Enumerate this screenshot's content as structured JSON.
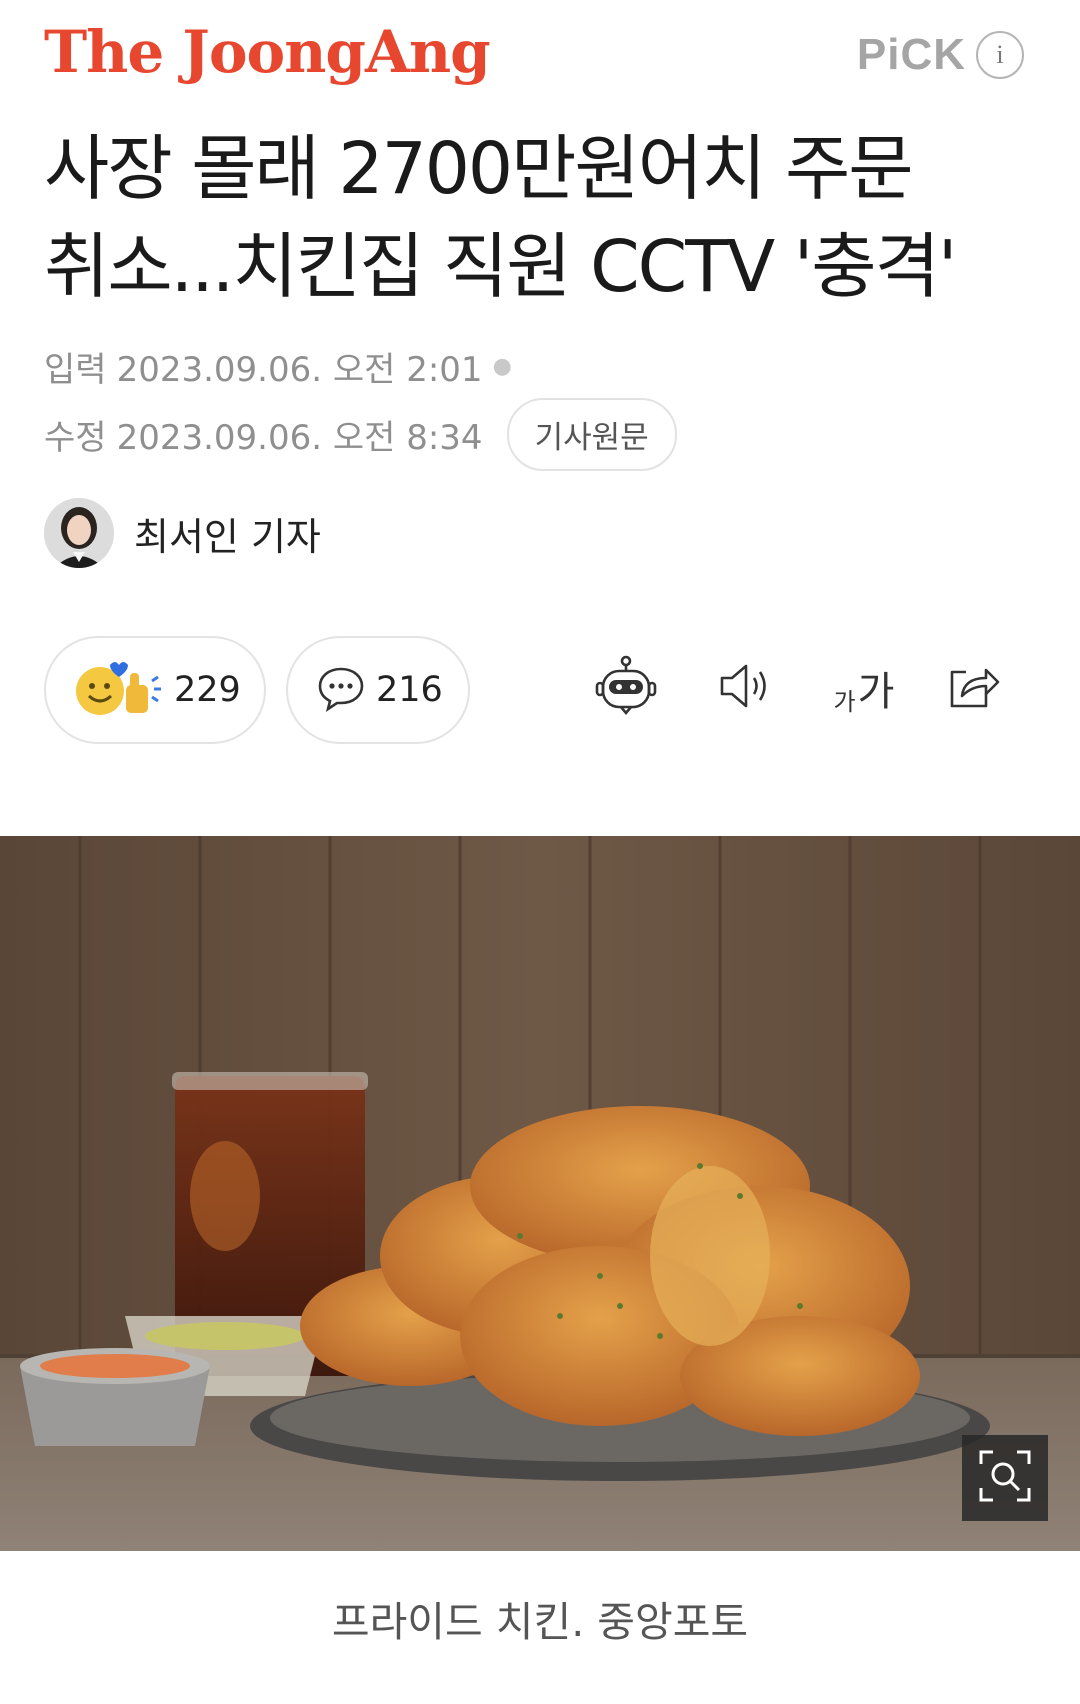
{
  "header": {
    "logo": "The JoongAng",
    "pick_label": "PiCK",
    "info_glyph": "i"
  },
  "article": {
    "title_line1": "사장 몰래 2700만원어치 주문",
    "title_line2": "취소...치킨집 직원 CCTV '충격'",
    "input_label": "입력",
    "input_datetime": "2023.09.06. 오전 2:01",
    "modified_label": "수정",
    "modified_datetime": "2023.09.06. 오전 8:34",
    "source_button": "기사원문",
    "author": "최서인 기자"
  },
  "actions": {
    "reaction_count": "229",
    "comment_count": "216",
    "font_size_label_small": "가",
    "font_size_label_large": "가",
    "icons": [
      "reaction-emoji-icon",
      "comment-bubble-icon",
      "summary-bot-icon",
      "speaker-icon",
      "font-size-icon",
      "share-icon"
    ]
  },
  "photo": {
    "caption": "프라이드 치킨. 중앙포토",
    "zoom_icon": "zoom-search-icon"
  },
  "colors": {
    "brand": "#e8472f",
    "meta_gray": "#8f8f8f",
    "border": "#e3e3e3"
  }
}
